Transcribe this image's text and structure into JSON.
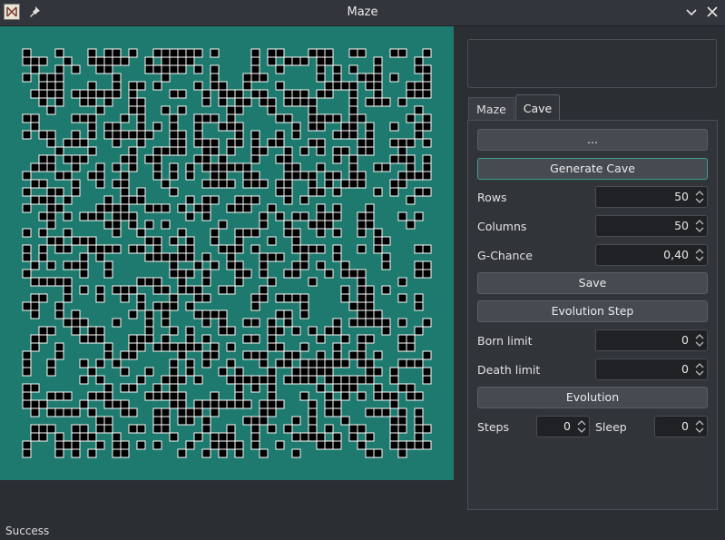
{
  "window": {
    "title": "Maze"
  },
  "icons": {
    "app": "maze-app-icon",
    "pin": "pin-icon",
    "minimize": "chevron-down-icon",
    "close": "close-icon"
  },
  "tabs": [
    {
      "label": "Maze",
      "active": false
    },
    {
      "label": "Cave",
      "active": true
    }
  ],
  "cave": {
    "load_button": "...",
    "generate_button": "Generate Cave",
    "rows": {
      "label": "Rows",
      "value": "50"
    },
    "columns": {
      "label": "Columns",
      "value": "50"
    },
    "chance": {
      "label": "G-Chance",
      "value": "0,40"
    },
    "save_button": "Save",
    "evolution_step_button": "Evolution Step",
    "born_limit": {
      "label": "Born limit",
      "value": "0"
    },
    "death_limit": {
      "label": "Death limit",
      "value": "0"
    },
    "evolution_button": "Evolution",
    "steps": {
      "label": "Steps",
      "value": "0"
    },
    "sleep": {
      "label": "Sleep",
      "value": "0"
    }
  },
  "canvas": {
    "background": "#1e7a6e",
    "cell_color": "#000000",
    "cell_border": "#ffffff",
    "grid_size": 50,
    "fill_chance": 0.4
  },
  "status": "Success"
}
